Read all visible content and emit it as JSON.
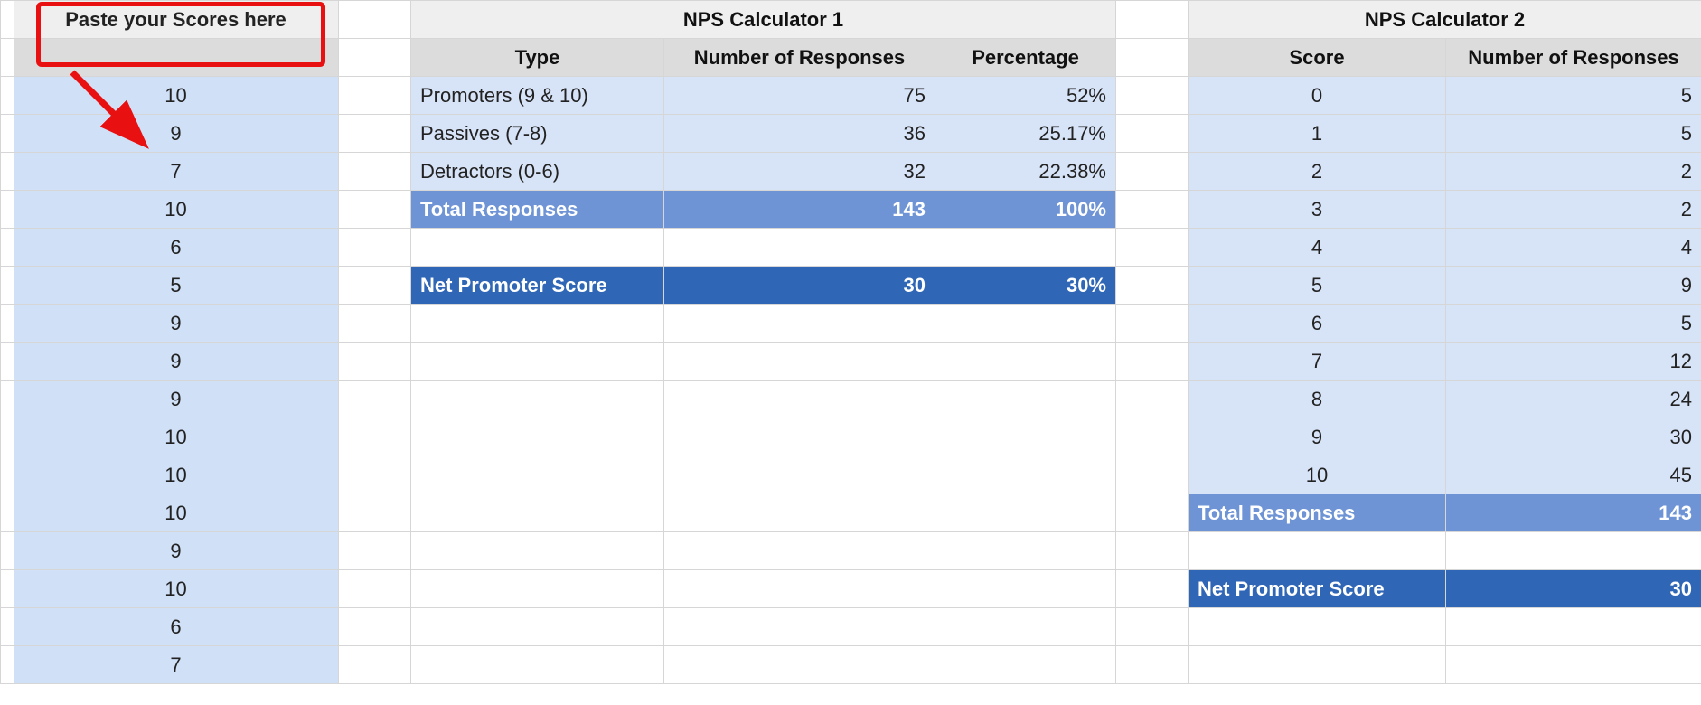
{
  "scores_header": "Paste your Scores here",
  "scores": [
    "10",
    "9",
    "7",
    "10",
    "6",
    "5",
    "9",
    "9",
    "9",
    "10",
    "10",
    "10",
    "9",
    "10",
    "6",
    "7"
  ],
  "calc1": {
    "title": "NPS Calculator 1",
    "col_type": "Type",
    "col_responses": "Number of Responses",
    "col_pct": "Percentage",
    "rows": [
      {
        "type": "Promoters (9 & 10)",
        "responses": "75",
        "pct": "52%"
      },
      {
        "type": "Passives (7-8)",
        "responses": "36",
        "pct": "25.17%"
      },
      {
        "type": "Detractors (0-6)",
        "responses": "32",
        "pct": "22.38%"
      }
    ],
    "total_label": "Total Responses",
    "total_responses": "143",
    "total_pct": "100%",
    "nps_label": "Net Promoter Score",
    "nps_value": "30",
    "nps_pct": "30%"
  },
  "calc2": {
    "title": "NPS Calculator 2",
    "col_score": "Score",
    "col_responses": "Number of Responses",
    "rows": [
      {
        "score": "0",
        "responses": "5"
      },
      {
        "score": "1",
        "responses": "5"
      },
      {
        "score": "2",
        "responses": "2"
      },
      {
        "score": "3",
        "responses": "2"
      },
      {
        "score": "4",
        "responses": "4"
      },
      {
        "score": "5",
        "responses": "9"
      },
      {
        "score": "6",
        "responses": "5"
      },
      {
        "score": "7",
        "responses": "12"
      },
      {
        "score": "8",
        "responses": "24"
      },
      {
        "score": "9",
        "responses": "30"
      },
      {
        "score": "10",
        "responses": "45"
      }
    ],
    "total_label": "Total Responses",
    "total_responses": "143",
    "nps_label": "Net Promoter Score",
    "nps_value": "30"
  },
  "annotation": {
    "box_color": "#e81010",
    "arrow_color": "#e81010"
  }
}
